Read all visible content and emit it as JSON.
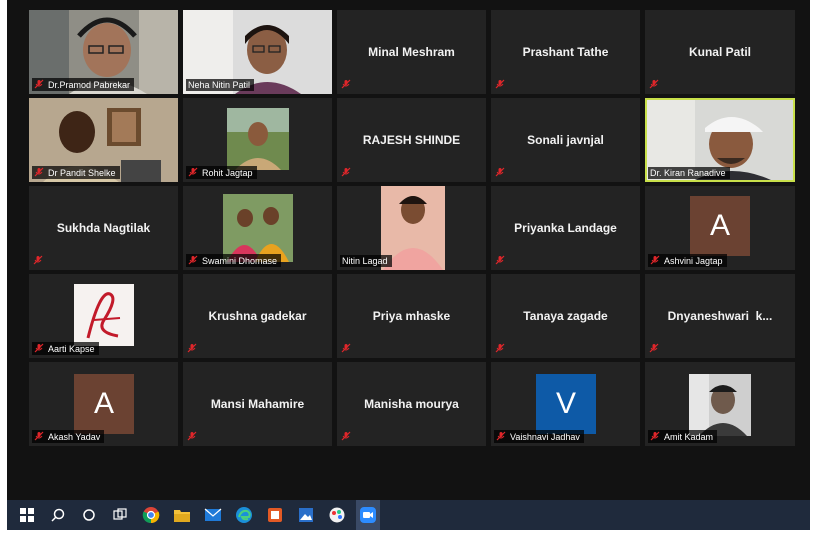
{
  "participants": [
    {
      "name": "Dr.Pramod Pabrekar",
      "video": true
    },
    {
      "name": "Neha Nitin Patil",
      "video": true
    },
    {
      "name": "Minal Meshram",
      "video": false
    },
    {
      "name": "Prashant Tathe",
      "video": false
    },
    {
      "name": "Kunal Patil",
      "video": false
    },
    {
      "name": "Dr Pandit Shelke",
      "video": true
    },
    {
      "name": "Rohit Jagtap",
      "video": true
    },
    {
      "name": "RAJESH SHINDE",
      "video": false
    },
    {
      "name": "Sonali javnjal",
      "video": false
    },
    {
      "name": "Dr. Kiran Ranadive",
      "video": true,
      "active_speaker": true
    },
    {
      "name": "Sukhda Nagtilak",
      "video": false
    },
    {
      "name": "Swamini Dhomase",
      "video": true
    },
    {
      "name": "Nitin Lagad",
      "video": true
    },
    {
      "name": "Priyanka Landage",
      "video": false
    },
    {
      "name": "Ashvini Jagtap",
      "avatar_letter": "A",
      "avatar_color": "#6b4232"
    },
    {
      "name": "Aarti Kapse",
      "video": true
    },
    {
      "name": "Krushna gadekar",
      "video": false
    },
    {
      "name": "Priya mhaske",
      "video": false
    },
    {
      "name": "Tanaya zagade",
      "video": false
    },
    {
      "name": "Dnyaneshwari  k...",
      "video": false
    },
    {
      "name": "Akash Yadav",
      "avatar_letter": "A",
      "avatar_color": "#6b4232"
    },
    {
      "name": "Mansi Mahamire",
      "video": false
    },
    {
      "name": "Manisha mourya",
      "video": false
    },
    {
      "name": "Vaishnavi Jadhav",
      "avatar_letter": "V",
      "avatar_color": "#0e5aa7"
    },
    {
      "name": "Amit Kadam",
      "video": true
    }
  ],
  "taskbar": {
    "icons": [
      "windows-start-icon",
      "search-icon",
      "cortana-icon",
      "task-view-icon",
      "chrome-icon",
      "file-explorer-icon",
      "mail-icon",
      "edge-icon",
      "office-icon",
      "photos-icon",
      "paint-icon",
      "zoom-icon"
    ]
  },
  "colors": {
    "active_speaker_border": "#c8e04a",
    "muted_icon": "#e0262a",
    "tile_bg": "#232323"
  }
}
